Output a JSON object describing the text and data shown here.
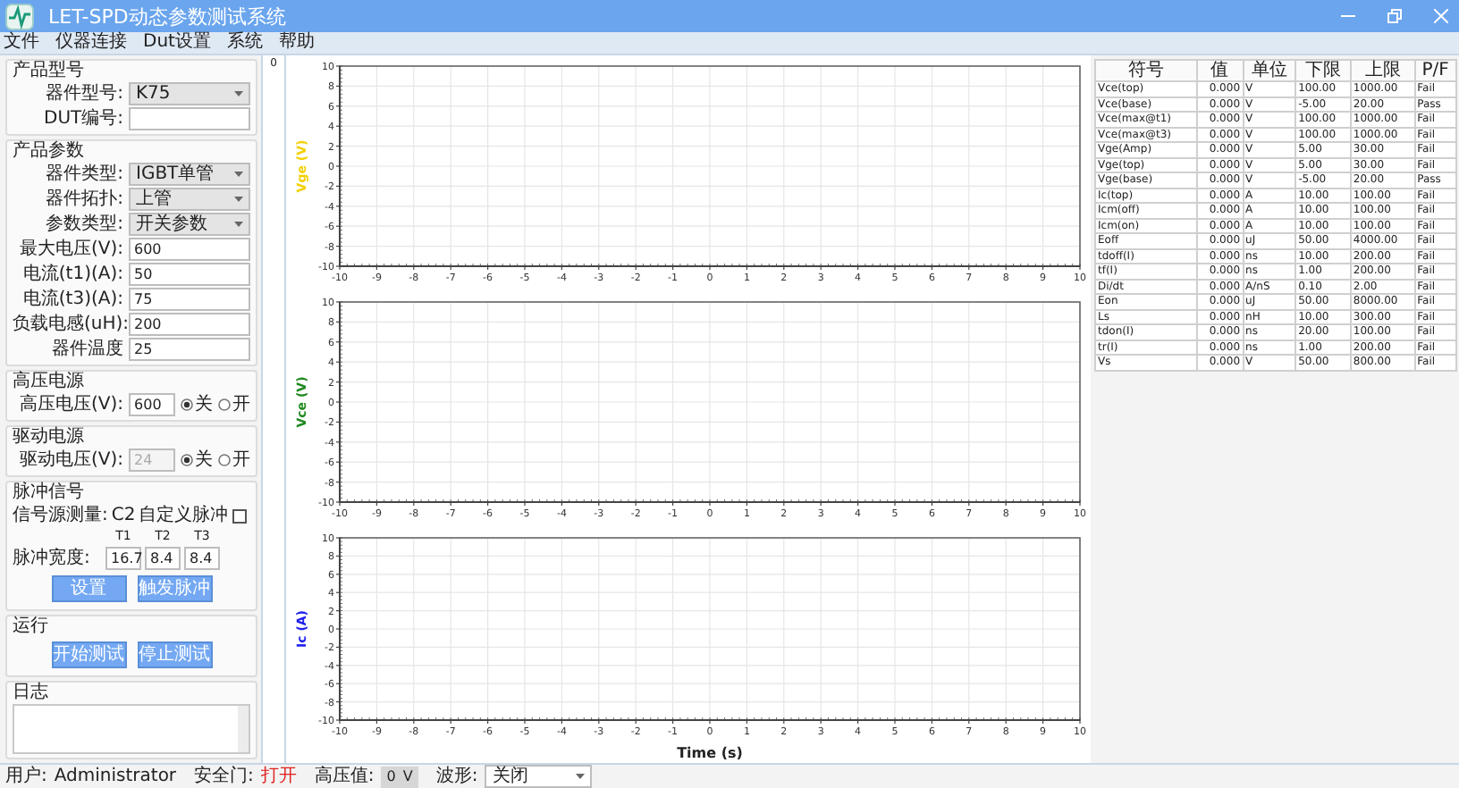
{
  "window": {
    "title": "LET-SPD动态参数测试系统"
  },
  "menu": [
    "文件",
    "仪器连接",
    "Dut设置",
    "系统",
    "帮助"
  ],
  "product_model": {
    "title": "产品型号",
    "fields": [
      {
        "label": "器件型号:",
        "kind": "select",
        "value": "K75"
      },
      {
        "label": "DUT编号:",
        "kind": "input"
      }
    ]
  },
  "product_params": {
    "title": "产品参数",
    "fields": [
      {
        "label": "器件类型:",
        "kind": "select",
        "value": "IGBT单管"
      },
      {
        "label": "器件拓扑:",
        "kind": "select",
        "value": "上管"
      },
      {
        "label": "参数类型:",
        "kind": "select",
        "value": "开关参数"
      },
      {
        "label": "最大电压(V):",
        "kind": "input",
        "value": "600"
      },
      {
        "label": "电流(t1)(A):",
        "kind": "input",
        "value": "50"
      },
      {
        "label": "电流(t3)(A):",
        "kind": "input",
        "value": "75"
      },
      {
        "label": "负载电感(uH):",
        "kind": "input",
        "value": "200"
      },
      {
        "label": "器件温度",
        "kind": "input",
        "value": "25"
      }
    ]
  },
  "hv_supply": {
    "title": "高压电源",
    "label": "高压电压(V):",
    "value": "600",
    "disabled": false,
    "options": [
      {
        "label": "关",
        "selected": true
      },
      {
        "label": "开",
        "selected": false
      }
    ]
  },
  "drive_supply": {
    "title": "驱动电源",
    "label": "驱动电压(V):",
    "value": "24",
    "disabled": true,
    "options": [
      {
        "label": "关",
        "selected": true
      },
      {
        "label": "开",
        "selected": false
      }
    ]
  },
  "pulse": {
    "title": "脉冲信号",
    "source_label": "信号源测量:",
    "source_value": "C2",
    "custom_label": "自定义脉冲",
    "custom_checked": false,
    "headers": [
      "T1",
      "T2",
      "T3"
    ],
    "width_label": "脉冲宽度:",
    "widths": [
      "16.7",
      "8.4",
      "8.4"
    ],
    "buttons": [
      "设置",
      "触发脉冲"
    ]
  },
  "run": {
    "title": "运行",
    "buttons": [
      "开始测试",
      "停止测试"
    ]
  },
  "log": {
    "title": "日志"
  },
  "strip": {
    "value": "0"
  },
  "charts": [
    {
      "color": "#f2d000",
      "chart_data": {
        "type": "line",
        "grid": true,
        "ylabel": "Vge (V)",
        "xlim": [
          -10,
          10
        ],
        "ylim": [
          -10,
          10
        ],
        "xticks": [
          -10,
          -9,
          -8,
          -7,
          -6,
          -5,
          -4,
          -3,
          -2,
          -1,
          0,
          1,
          2,
          3,
          4,
          5,
          6,
          7,
          8,
          9,
          10
        ],
        "yticks": [
          -10,
          -8,
          -6,
          -4,
          -2,
          0,
          2,
          4,
          6,
          8,
          10
        ]
      }
    },
    {
      "color": "#1f8a1f",
      "chart_data": {
        "type": "line",
        "grid": true,
        "ylabel": "Vce (V)",
        "xlim": [
          -10,
          10
        ],
        "ylim": [
          -10,
          10
        ],
        "xticks": [
          -10,
          -9,
          -8,
          -7,
          -6,
          -5,
          -4,
          -3,
          -2,
          -1,
          0,
          1,
          2,
          3,
          4,
          5,
          6,
          7,
          8,
          9,
          10
        ],
        "yticks": [
          -10,
          -8,
          -6,
          -4,
          -2,
          0,
          2,
          4,
          6,
          8,
          10
        ]
      }
    },
    {
      "color": "#2020f0",
      "chart_data": {
        "type": "line",
        "grid": true,
        "xlabel": "Time (s)",
        "ylabel": "Ic (A)",
        "xlim": [
          -10,
          10
        ],
        "ylim": [
          -10,
          10
        ],
        "xticks": [
          -10,
          -9,
          -8,
          -7,
          -6,
          -5,
          -4,
          -3,
          -2,
          -1,
          0,
          1,
          2,
          3,
          4,
          5,
          6,
          7,
          8,
          9,
          10
        ],
        "yticks": [
          -10,
          -8,
          -6,
          -4,
          -2,
          0,
          2,
          4,
          6,
          8,
          10
        ]
      }
    }
  ],
  "results": {
    "columns": [
      "符号",
      "值",
      "单位",
      "下限",
      "上限",
      "P/F"
    ],
    "rows": [
      [
        "Vce(top)",
        "0.000",
        "V",
        "100.00",
        "1000.00",
        "Fail"
      ],
      [
        "Vce(base)",
        "0.000",
        "V",
        "-5.00",
        "20.00",
        "Pass"
      ],
      [
        "Vce(max@t1)",
        "0.000",
        "V",
        "100.00",
        "1000.00",
        "Fail"
      ],
      [
        "Vce(max@t3)",
        "0.000",
        "V",
        "100.00",
        "1000.00",
        "Fail"
      ],
      [
        "Vge(Amp)",
        "0.000",
        "V",
        "5.00",
        "30.00",
        "Fail"
      ],
      [
        "Vge(top)",
        "0.000",
        "V",
        "5.00",
        "30.00",
        "Fail"
      ],
      [
        "Vge(base)",
        "0.000",
        "V",
        "-5.00",
        "20.00",
        "Pass"
      ],
      [
        "Ic(top)",
        "0.000",
        "A",
        "10.00",
        "100.00",
        "Fail"
      ],
      [
        "Icm(off)",
        "0.000",
        "A",
        "10.00",
        "100.00",
        "Fail"
      ],
      [
        "Icm(on)",
        "0.000",
        "A",
        "10.00",
        "100.00",
        "Fail"
      ],
      [
        "Eoff",
        "0.000",
        "uJ",
        "50.00",
        "4000.00",
        "Fail"
      ],
      [
        "tdoff(I)",
        "0.000",
        "ns",
        "10.00",
        "200.00",
        "Fail"
      ],
      [
        "tf(I)",
        "0.000",
        "ns",
        "1.00",
        "200.00",
        "Fail"
      ],
      [
        "Di/dt",
        "0.000",
        "A/nS",
        "0.10",
        "2.00",
        "Fail"
      ],
      [
        "Eon",
        "0.000",
        "uJ",
        "50.00",
        "8000.00",
        "Fail"
      ],
      [
        "Ls",
        "0.000",
        "nH",
        "10.00",
        "300.00",
        "Fail"
      ],
      [
        "tdon(I)",
        "0.000",
        "ns",
        "20.00",
        "100.00",
        "Fail"
      ],
      [
        "tr(I)",
        "0.000",
        "ns",
        "1.00",
        "200.00",
        "Fail"
      ],
      [
        "Vs",
        "0.000",
        "V",
        "50.00",
        "800.00",
        "Fail"
      ]
    ]
  },
  "status": {
    "user_label": "用户:",
    "user": "Administrator",
    "door_label": "安全门:",
    "door": "打开",
    "hv_label": "高压值:",
    "hv_value": "0",
    "hv_unit": "V",
    "wave_label": "波形:",
    "wave_value": "关闭"
  }
}
